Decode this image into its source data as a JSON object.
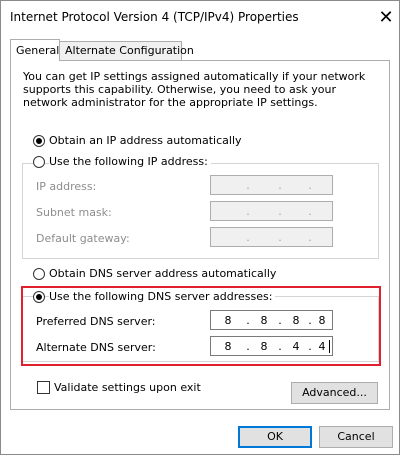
{
  "window": {
    "title": "Internet Protocol Version 4 (TCP/IPv4) Properties",
    "close_icon": "close-icon"
  },
  "tabs": [
    {
      "label": "General",
      "active": true
    },
    {
      "label": "Alternate Configuration",
      "active": false
    }
  ],
  "description": "You can get IP settings assigned automatically if your network supports this capability. Otherwise, you need to ask your network administrator for the appropriate IP settings.",
  "ip_section": {
    "obtain_auto_label": "Obtain an IP address automatically",
    "obtain_auto_selected": true,
    "use_following_label": "Use the following IP address:",
    "use_following_selected": false,
    "fields": [
      {
        "label": "IP address:",
        "octets": [
          "",
          "",
          "",
          ""
        ]
      },
      {
        "label": "Subnet mask:",
        "octets": [
          "",
          "",
          "",
          ""
        ]
      },
      {
        "label": "Default gateway:",
        "octets": [
          "",
          "",
          "",
          ""
        ]
      }
    ]
  },
  "dns_section": {
    "obtain_auto_label": "Obtain DNS server address automatically",
    "obtain_auto_selected": false,
    "use_following_label": "Use the following DNS server addresses:",
    "use_following_selected": true,
    "preferred": {
      "label": "Preferred DNS server:",
      "octets": [
        "8",
        "8",
        "8",
        "8"
      ]
    },
    "alternate": {
      "label": "Alternate DNS server:",
      "octets": [
        "8",
        "8",
        "4",
        "4"
      ]
    }
  },
  "highlight_color": "#e0202c",
  "validate_label": "Validate settings upon exit",
  "validate_checked": false,
  "buttons": {
    "advanced": "Advanced...",
    "ok": "OK",
    "cancel": "Cancel"
  }
}
